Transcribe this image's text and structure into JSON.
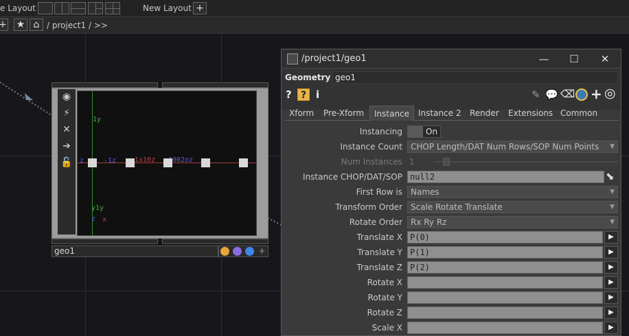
{
  "topbar": {
    "layout_label": "e Layout",
    "new_layout_label": "New Layout",
    "add_label": "+"
  },
  "pathbar": {
    "add_label": "+",
    "path": "/ project1 / >>"
  },
  "node": {
    "name": "geo1",
    "viewer_labels": [
      "1y",
      "z",
      "-1z",
      "1x10z",
      "1002oz",
      "y1y",
      "z",
      "x"
    ],
    "dot_colors": [
      "#e8a33a",
      "#8a6be0",
      "#3f86e6",
      "#777777"
    ]
  },
  "param_window": {
    "title": "/project1/geo1",
    "op_type": "Geometry",
    "op_name": "geo1",
    "help_label": "?",
    "info_label": "i",
    "tabs": [
      "Xform",
      "Pre-Xform",
      "Instance",
      "Instance 2",
      "Render",
      "Extensions",
      "Common"
    ],
    "active_tab": "Instance",
    "params": {
      "instancing": {
        "label": "Instancing",
        "value": "On"
      },
      "instance_count": {
        "label": "Instance Count",
        "value": "CHOP Length/DAT Num Rows/SOP Num Points"
      },
      "num_instances": {
        "label": "Num Instances",
        "value": "1"
      },
      "instance_op": {
        "label": "Instance CHOP/DAT/SOP",
        "value": "null2"
      },
      "first_row": {
        "label": "First Row is",
        "value": "Names"
      },
      "transform_order": {
        "label": "Transform Order",
        "value": "Scale Rotate Translate"
      },
      "rotate_order": {
        "label": "Rotate Order",
        "value": "Rx Ry Rz"
      },
      "translate_x": {
        "label": "Translate X",
        "value": "P(0)"
      },
      "translate_y": {
        "label": "Translate Y",
        "value": "P(1)"
      },
      "translate_z": {
        "label": "Translate Z",
        "value": "P(2)"
      },
      "rotate_x": {
        "label": "Rotate X",
        "value": ""
      },
      "rotate_y": {
        "label": "Rotate Y",
        "value": ""
      },
      "rotate_z": {
        "label": "Rotate Z",
        "value": ""
      },
      "scale_x": {
        "label": "Scale X",
        "value": ""
      }
    },
    "accent": "#e8b54a"
  }
}
